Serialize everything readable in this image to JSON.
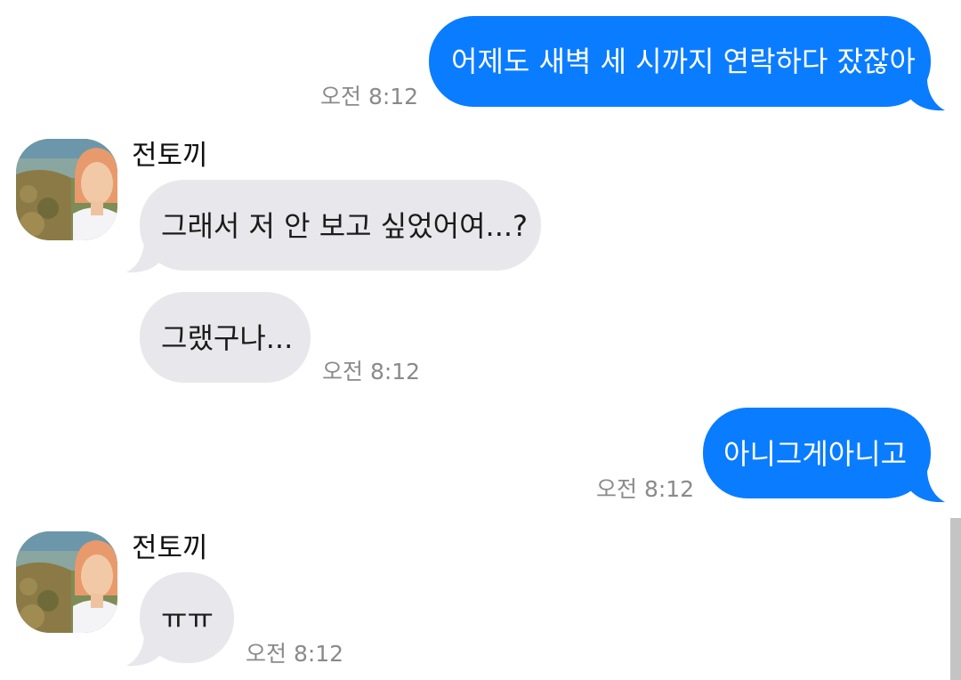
{
  "conversation": {
    "messages": [
      {
        "direction": "outgoing",
        "text": "어제도 새벽 세 시까지 연락하다 잤잖아",
        "time": "오전 8:12"
      },
      {
        "direction": "incoming",
        "sender": "전토끼",
        "text": "그래서 저 안 보고 싶었어여...?"
      },
      {
        "direction": "incoming",
        "text": "그랬구나...",
        "time": "오전 8:12"
      },
      {
        "direction": "outgoing",
        "text": "아니그게아니고",
        "time": "오전 8:12"
      },
      {
        "direction": "incoming",
        "sender": "전토끼",
        "text": "ㅠㅠ",
        "time": "오전 8:12"
      }
    ]
  },
  "colors": {
    "outgoing_bubble": "#0a7cff",
    "incoming_bubble": "#e8e8ec",
    "timestamp": "#8a8a8a"
  }
}
